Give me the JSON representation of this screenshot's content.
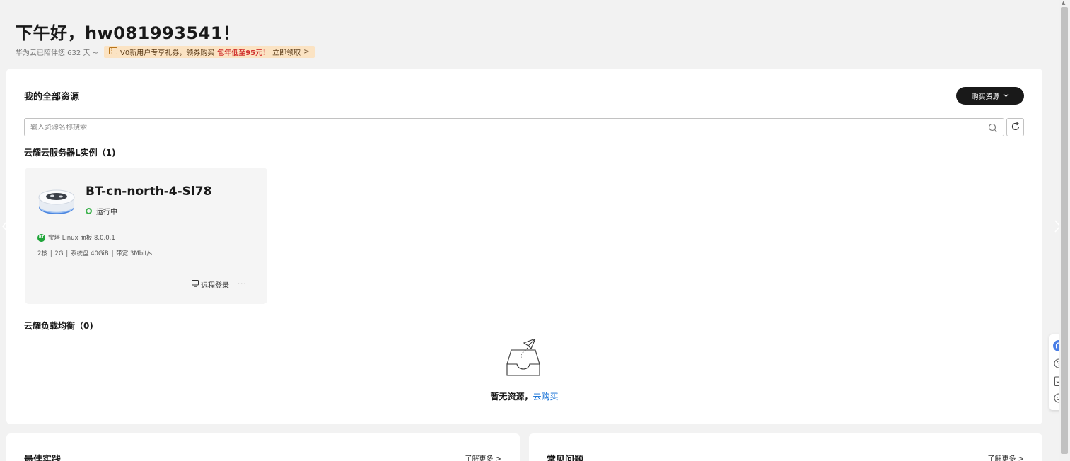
{
  "greeting": "下午好，hw081993541！",
  "days_text": "华为云已陪伴您 632 天 ~",
  "promo": {
    "pre": "V0新用户专享礼券，领券购买",
    "highlight": "包年低至95元！",
    "post": "立即领取",
    "chevron": ">"
  },
  "resources": {
    "title": "我的全部资源",
    "buy_button": "购买资源",
    "search_placeholder": "输入资源名称搜索",
    "section_instances": "云耀云服务器L实例（1)",
    "instance": {
      "name": "BT-cn-north-4-Sl78",
      "status": "运行中",
      "image": "宝塔 Linux 面板 8.0.0.1",
      "bt_badge": "BT",
      "specs": "2核 │ 2G │ 系统盘 40GiB │ 带宽 3Mbit/s",
      "remote_login": "远程登录",
      "more": "···"
    },
    "section_lb": "云耀负载均衡（0)",
    "empty_text": "暂无资源，",
    "empty_link": "去购买"
  },
  "best_practice": {
    "title": "最佳实践",
    "more": "了解更多 >"
  },
  "faq": {
    "title": "常见问题",
    "more": "了解更多 >"
  },
  "colors": {
    "accent": "#191919",
    "link": "#0a6ad4",
    "running": "#3fb34f",
    "promo_bg": "#fbe3c3"
  }
}
